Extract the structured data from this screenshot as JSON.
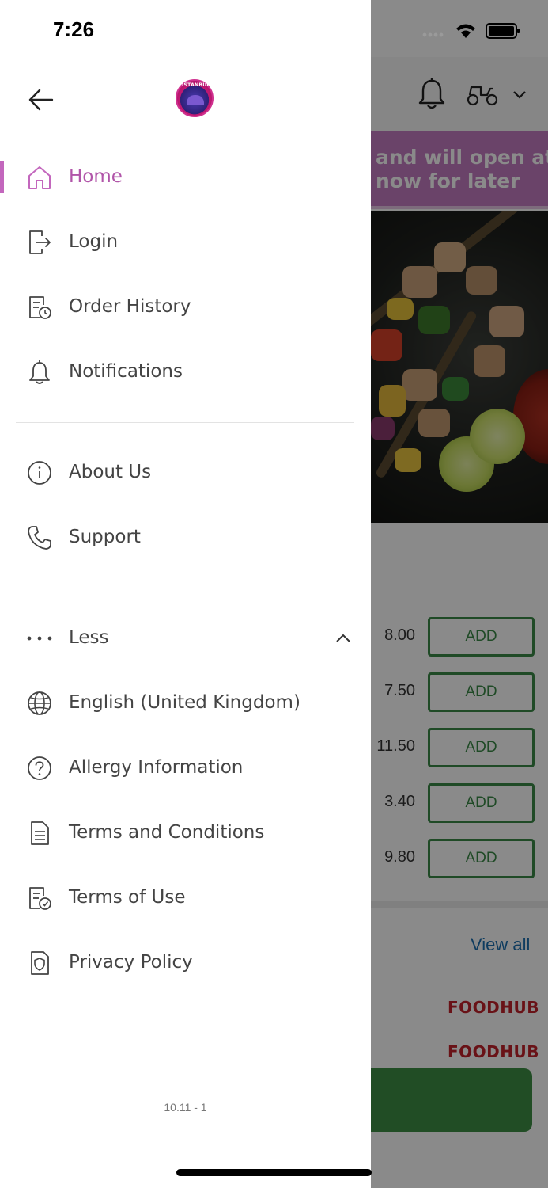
{
  "status_bar": {
    "time": "7:26"
  },
  "background": {
    "banner_lines": [
      "and will open at",
      "now for later"
    ],
    "menu_rows": [
      {
        "price": "8.00",
        "button": "ADD"
      },
      {
        "price": "7.50",
        "button": "ADD"
      },
      {
        "price": "11.50",
        "button": "ADD"
      },
      {
        "price": "3.40",
        "button": "ADD"
      },
      {
        "price": "9.80",
        "button": "ADD"
      }
    ],
    "view_all": "View all",
    "brand_labels": [
      "FOODHUB",
      "FOODHUB"
    ]
  },
  "drawer": {
    "logo_text": "ISTANBUL",
    "primary_items": [
      {
        "label": "Home",
        "icon": "home-icon",
        "active": true
      },
      {
        "label": "Login",
        "icon": "login-icon"
      },
      {
        "label": "Order History",
        "icon": "order-history-icon"
      },
      {
        "label": "Notifications",
        "icon": "bell-icon"
      }
    ],
    "secondary_items": [
      {
        "label": "About Us",
        "icon": "info-icon"
      },
      {
        "label": "Support",
        "icon": "phone-icon"
      }
    ],
    "more_toggle": {
      "label": "Less",
      "icon": "more-dots-icon"
    },
    "extra_items": [
      {
        "label": "English (United Kingdom)",
        "icon": "globe-icon"
      },
      {
        "label": "Allergy Information",
        "icon": "question-icon"
      },
      {
        "label": "Terms and Conditions",
        "icon": "document-icon"
      },
      {
        "label": "Terms of Use",
        "icon": "document-check-icon"
      },
      {
        "label": "Privacy Policy",
        "icon": "shield-icon"
      }
    ],
    "version": "10.11 - 1"
  },
  "colors": {
    "accent": "#c367bd",
    "banner": "#c47cc2",
    "add_button": "#3a8a46",
    "cart_bar": "#3e8f45",
    "link": "#1d6fb0"
  }
}
